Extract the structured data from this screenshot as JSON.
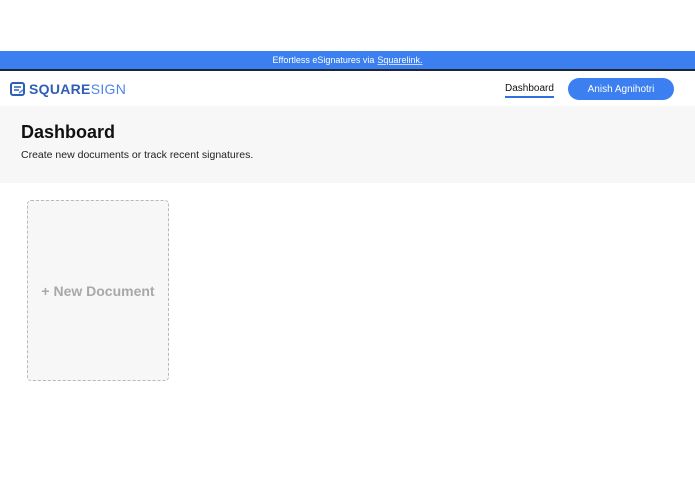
{
  "banner": {
    "text": "Effortless eSignatures via",
    "link_text": "Squarelink."
  },
  "brand": {
    "name_primary": "SQUARE",
    "name_secondary": "SIGN",
    "logo_icon": "document-icon",
    "primary_color": "#2f5fb3",
    "secondary_color": "#4a86e8"
  },
  "nav": {
    "dashboard_label": "Dashboard",
    "user_name": "Anish Agnihotri"
  },
  "header": {
    "title": "Dashboard",
    "subtitle": "Create new documents or track recent signatures."
  },
  "main": {
    "new_document_label": "+ New Document"
  },
  "colors": {
    "accent": "#3b7ff0",
    "banner_bg": "#3b7ff0",
    "header_bg": "#f7f7f7"
  }
}
